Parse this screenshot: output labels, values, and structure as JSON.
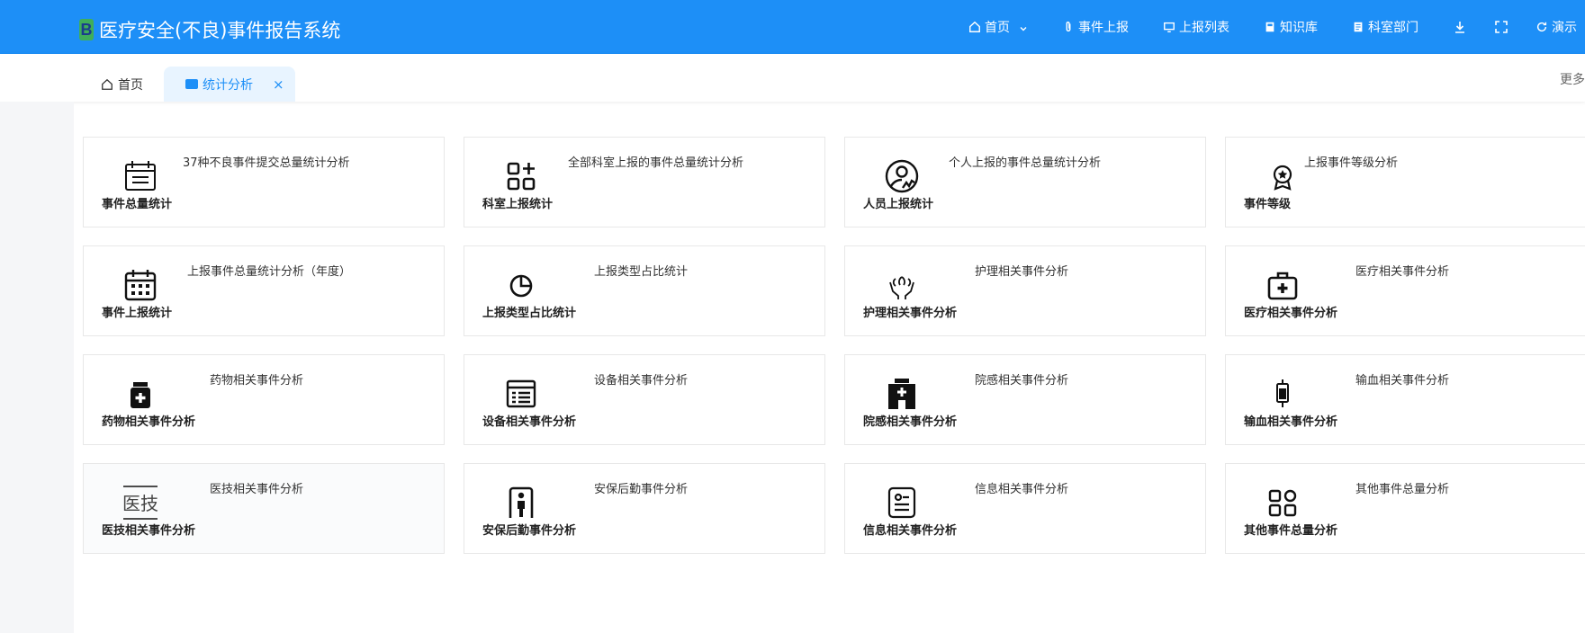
{
  "header": {
    "logo_letter": "B",
    "app_title": "医疗安全(不良)事件报告系统",
    "nav": [
      {
        "label": "首页",
        "icon": "home-icon"
      },
      {
        "label": "事件上报",
        "icon": "paperclip-icon"
      },
      {
        "label": "上报列表",
        "icon": "monitor-icon"
      },
      {
        "label": "知识库",
        "icon": "book-icon"
      },
      {
        "label": "科室部门",
        "icon": "document-icon"
      }
    ],
    "demo_label": "演示"
  },
  "tabs": {
    "home_label": "首页",
    "active_label": "统计分析",
    "close": "×",
    "more_label": "更多"
  },
  "cards": [
    {
      "title": "事件总量统计",
      "desc": "37种不良事件提交总量统计分析",
      "icon": "calendar-list-icon"
    },
    {
      "title": "科室上报统计",
      "desc": "全部科室上报的事件总量统计分析",
      "icon": "grid-plus-icon"
    },
    {
      "title": "人员上报统计",
      "desc": "个人上报的事件总量统计分析",
      "icon": "user-signature-icon"
    },
    {
      "title": "事件等级",
      "desc": "上报事件等级分析",
      "icon": "award-icon"
    },
    {
      "title": "事件上报统计",
      "desc": "上报事件总量统计分析（年度）",
      "icon": "calendar-grid-icon"
    },
    {
      "title": "上报类型占比统计",
      "desc": "上报类型占比统计",
      "icon": "pie-chart-icon"
    },
    {
      "title": "护理相关事件分析",
      "desc": "护理相关事件分析",
      "icon": "care-hands-icon"
    },
    {
      "title": "医疗相关事件分析",
      "desc": "医疗相关事件分析",
      "icon": "medical-kit-icon"
    },
    {
      "title": "药物相关事件分析",
      "desc": "药物相关事件分析",
      "icon": "medicine-bottle-icon"
    },
    {
      "title": "设备相关事件分析",
      "desc": "设备相关事件分析",
      "icon": "equipment-list-icon"
    },
    {
      "title": "院感相关事件分析",
      "desc": "院感相关事件分析",
      "icon": "hospital-icon"
    },
    {
      "title": "输血相关事件分析",
      "desc": "输血相关事件分析",
      "icon": "blood-bag-icon"
    },
    {
      "title": "医技相关事件分析",
      "desc": "医技相关事件分析",
      "icon": "medtech-text-icon",
      "icon_text": "医技"
    },
    {
      "title": "安保后勤事件分析",
      "desc": "安保后勤事件分析",
      "icon": "security-gate-icon"
    },
    {
      "title": "信息相关事件分析",
      "desc": "信息相关事件分析",
      "icon": "info-card-icon"
    },
    {
      "title": "其他事件总量分析",
      "desc": "其他事件总量分析",
      "icon": "apps-grid-icon"
    }
  ],
  "colors": {
    "header_bg": "#1d8ff7",
    "logo_bg": "#3fae5a",
    "active_tab_bg": "#e8f4ff"
  }
}
